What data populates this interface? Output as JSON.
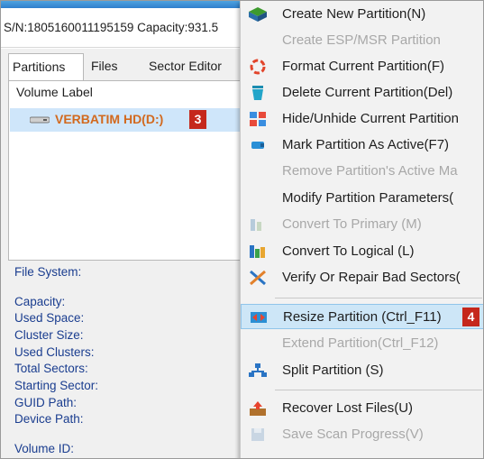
{
  "info_bar": {
    "text": "S/N:1805160011195159  Capacity:931.5"
  },
  "tabs": [
    {
      "label": "Partitions"
    },
    {
      "label": "Files"
    },
    {
      "label": "Sector Editor"
    }
  ],
  "list": {
    "header": "Volume Label",
    "volume": {
      "name": "VERBATIM HD(D:)",
      "badge": "3"
    }
  },
  "properties": [
    {
      "label": "File System:"
    },
    {
      "label": "Capacity:"
    },
    {
      "label": "Used Space:"
    },
    {
      "label": "Cluster Size:"
    },
    {
      "label": "Used Clusters:"
    },
    {
      "label": "Total Sectors:"
    },
    {
      "label": "Starting Sector:"
    },
    {
      "label": "GUID Path:"
    },
    {
      "label": "Device Path:"
    },
    {
      "label": "Volume ID:"
    }
  ],
  "context_menu": {
    "items": [
      {
        "label": "Create New Partition(N)",
        "icon": "create-partition-icon",
        "disabled": false
      },
      {
        "label": "Create ESP/MSR Partition",
        "icon": "",
        "disabled": true
      },
      {
        "label": "Format Current Partition(F)",
        "icon": "format-icon",
        "disabled": false
      },
      {
        "label": "Delete Current Partition(Del)",
        "icon": "delete-icon",
        "disabled": false
      },
      {
        "label": "Hide/Unhide Current Partition",
        "icon": "hide-unhide-icon",
        "disabled": false
      },
      {
        "label": "Mark Partition As Active(F7)",
        "icon": "mark-active-icon",
        "disabled": false
      },
      {
        "label": "Remove Partition's Active Ma",
        "icon": "",
        "disabled": true
      },
      {
        "label": "Modify Partition Parameters(",
        "icon": "",
        "disabled": false
      },
      {
        "label": "Convert To Primary (M)",
        "icon": "convert-primary-icon",
        "disabled": true
      },
      {
        "label": "Convert To Logical (L)",
        "icon": "convert-logical-icon",
        "disabled": false
      },
      {
        "label": "Verify Or Repair Bad Sectors(",
        "icon": "verify-repair-icon",
        "disabled": false
      },
      {
        "label": "Resize Partition (Ctrl_F11)",
        "icon": "resize-icon",
        "disabled": false,
        "highlighted": true,
        "badge": "4"
      },
      {
        "label": "Extend Partition(Ctrl_F12)",
        "icon": "",
        "disabled": true
      },
      {
        "label": "Split Partition (S)",
        "icon": "split-icon",
        "disabled": false
      },
      {
        "label": "Recover Lost Files(U)",
        "icon": "recover-files-icon",
        "disabled": false
      },
      {
        "label": "Save Scan Progress(V)",
        "icon": "save-scan-icon",
        "disabled": true
      }
    ]
  },
  "colors": {
    "accent_blue": "#2f7fcc",
    "volume_text": "#d2691e",
    "badge_red": "#c5281c",
    "highlight": "#cde6f7"
  }
}
